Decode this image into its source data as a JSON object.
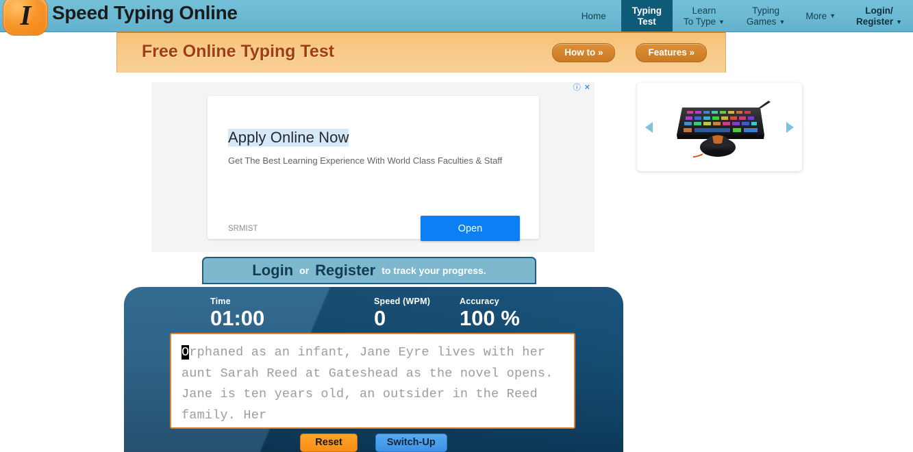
{
  "header": {
    "logo_letter": "I",
    "site_title": "Speed Typing Online",
    "nav": [
      {
        "label": "Home",
        "caret": ""
      },
      {
        "label_line1": "Typing",
        "label_line2": "Test",
        "caret": ""
      },
      {
        "label_line1": "Learn",
        "label_line2": "To Type",
        "caret": "▼"
      },
      {
        "label_line1": "Typing",
        "label_line2": "Games",
        "caret": "▼"
      },
      {
        "label": "More",
        "caret": "▼"
      },
      {
        "label_line1": "Login/",
        "label_line2": "Register",
        "caret": "▼"
      }
    ]
  },
  "banner": {
    "title": "Free Online Typing Test",
    "how_to_label": "How to »",
    "features_label": "Features »"
  },
  "ad": {
    "info_icon": "ⓘ",
    "close_icon": "✕",
    "headline": "Apply Online Now",
    "description": "Get The Best Learning Experience With World Class Faculties & Staff",
    "brand": "SRMIST",
    "open_label": "Open"
  },
  "carousel": {
    "prev_label": "",
    "next_label": "",
    "product_alt": "gaming-keyboard-and-mouse"
  },
  "login_bar": {
    "login_label": "Login",
    "or_label": "or",
    "register_label": "Register",
    "tail_text": "to track your progress."
  },
  "test": {
    "stats": [
      {
        "label": "Time",
        "value": "01:00"
      },
      {
        "label": "Speed (WPM)",
        "value": "0"
      },
      {
        "label": "Accuracy",
        "value": "100 %"
      }
    ],
    "cursor_char": "O",
    "passage_rest": "rphaned as an infant, Jane Eyre lives with her aunt Sarah Reed at Gateshead as the novel opens. Jane is ten years old, an outsider in the Reed family. Her",
    "reset_label": "Reset",
    "switch_label": "Switch-Up"
  },
  "colors": {
    "header_teal": "#6bb9d3",
    "nav_active": "#0e5b78",
    "banner_orange": "#f8c987",
    "banner_title": "#a13d10",
    "pill_orange": "#d2822a",
    "ad_blue": "#0b7ff5",
    "panel_blue": "#17527b",
    "textarea_border": "#e8822a",
    "reset_orange": "#f98e16",
    "switch_blue": "#3b93e6",
    "arrow_blue": "#7ec3dc"
  }
}
